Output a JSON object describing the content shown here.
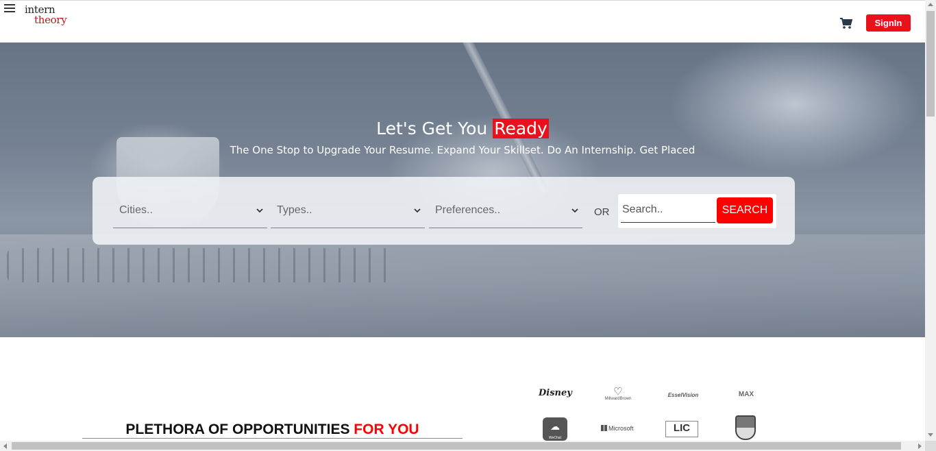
{
  "header": {
    "logo": {
      "line1": "intern",
      "line2": "theory"
    },
    "signin_label": "SignIn"
  },
  "hero": {
    "title_plain": "Let's Get You ",
    "title_highlight": "Ready",
    "subtitle": "The One Stop to Upgrade Your Resume. Expand Your Skillset. Do An Internship. Get Placed"
  },
  "search": {
    "cities_placeholder": "Cities..",
    "types_placeholder": "Types..",
    "preferences_placeholder": "Preferences..",
    "or_label": "OR",
    "input_placeholder": "Search..",
    "button_label": "SEARCH"
  },
  "opportunities": {
    "title_black": "PLETHORA OF OPPORTUNITIES ",
    "title_red": "FOR YOU"
  },
  "brands": {
    "disney": "Disney",
    "millward_brown_glyph": "♡",
    "millward_brown": "MillwardBrown",
    "essel_vision": "EsselVision",
    "max": "MAX",
    "wechat_glyph": "☁",
    "wechat": "WeChat",
    "microsoft": "Microsoft",
    "lic": "LIC"
  },
  "colors": {
    "accent": "#e8111c",
    "search_button": "#ff0000"
  }
}
